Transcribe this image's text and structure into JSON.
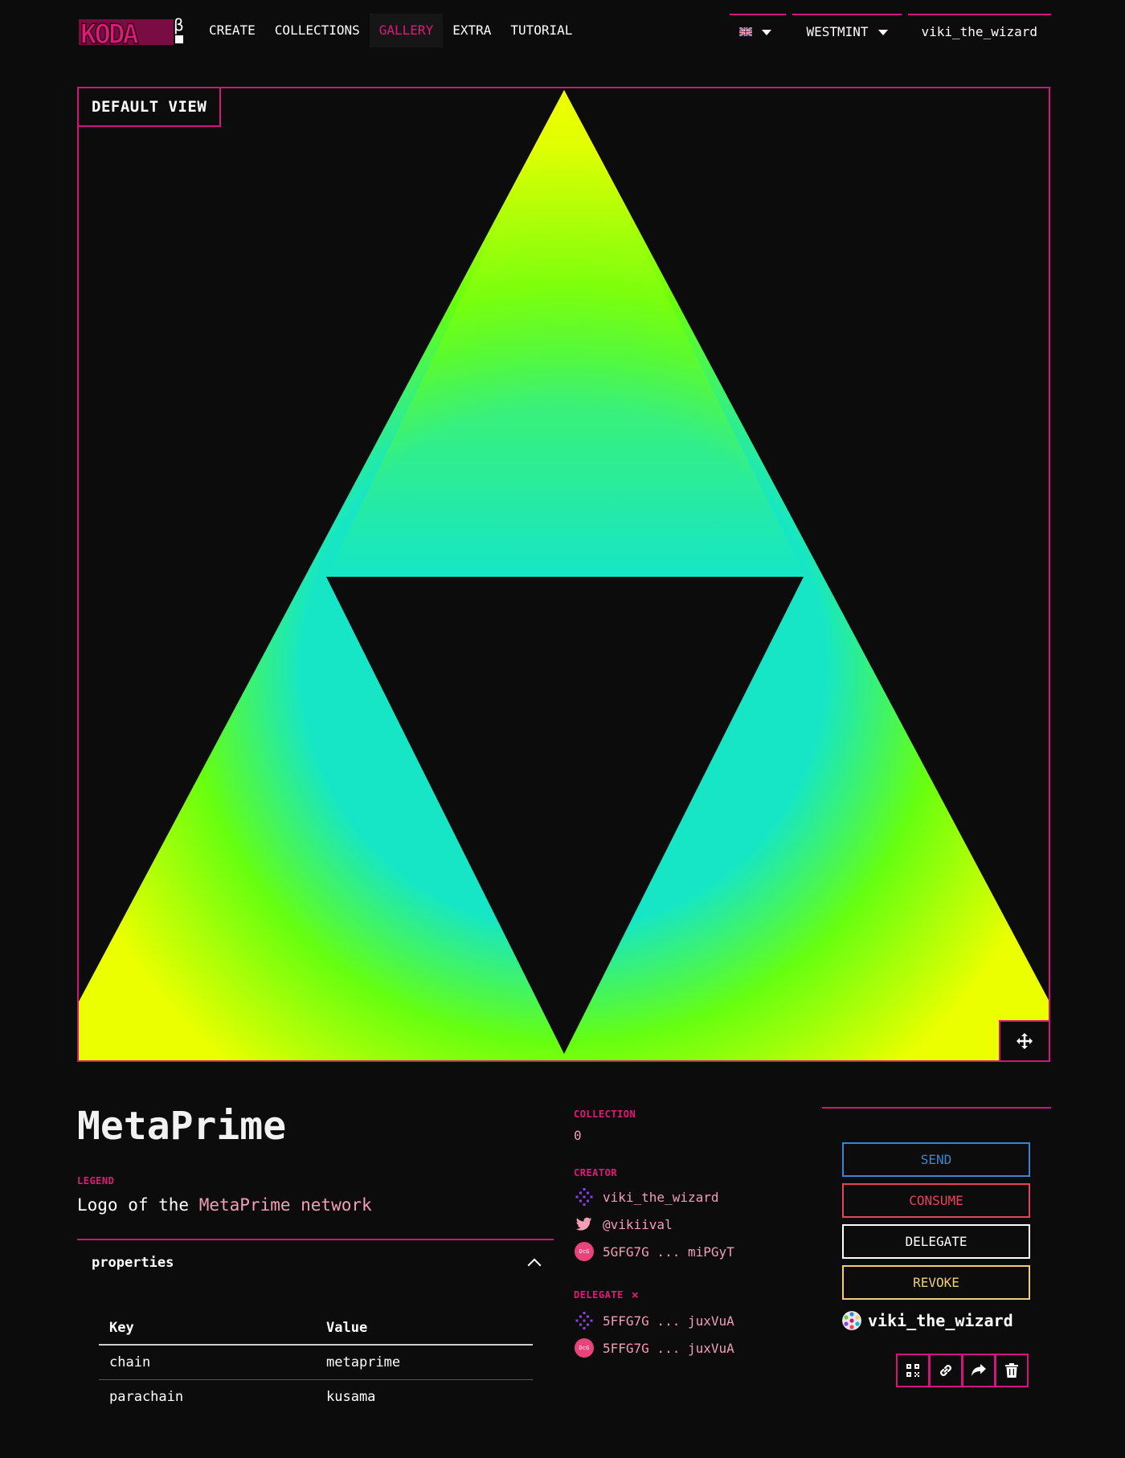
{
  "nav": {
    "logo_text": "KODA",
    "logo_badge": "β",
    "links": [
      {
        "label": "CREATE",
        "active": false
      },
      {
        "label": "COLLECTIONS",
        "active": false
      },
      {
        "label": "GALLERY",
        "active": true
      },
      {
        "label": "EXTRA",
        "active": false
      },
      {
        "label": "TUTORIAL",
        "active": false
      }
    ],
    "language_icon": "uk-flag-icon",
    "network_label": "WESTMINT",
    "account_label": "viki_the_wizard"
  },
  "media": {
    "view_label": "DEFAULT VIEW",
    "fullscreen_icon": "move-arrows-icon",
    "gradient_colors": [
      "#e8ff00",
      "#66ff00",
      "#16e6c6"
    ]
  },
  "nft": {
    "title": "MetaPrime",
    "legend_label": "LEGEND",
    "legend_prefix": "Logo of the ",
    "legend_highlight": "MetaPrime network",
    "properties_title": "properties",
    "properties_header": {
      "key": "Key",
      "value": "Value"
    },
    "properties": [
      {
        "key": "chain",
        "value": "metaprime"
      },
      {
        "key": "parachain",
        "value": "kusama"
      }
    ]
  },
  "meta": {
    "collection_label": "COLLECTION",
    "collection_value": "0",
    "creator_label": "CREATOR",
    "creator_name": "viki_the_wizard",
    "creator_twitter": "@vikiival",
    "creator_address": "5GFG7G ... miPGyT",
    "delegate_label": "DELEGATE",
    "delegate_close": "×",
    "delegate_identity": "5FFG7G ... juxVuA",
    "delegate_address": "5FFG7G ... juxVuA"
  },
  "actions": {
    "send": "SEND",
    "consume": "CONSUME",
    "delegate": "DELEGATE",
    "revoke": "REVOKE",
    "owner_name": "viki_the_wizard",
    "icons": [
      "qr-code-icon",
      "link-icon",
      "share-icon",
      "trash-icon"
    ]
  },
  "colors": {
    "accent": "#d3147c",
    "send": "#3a86d4",
    "consume": "#e8435c",
    "revoke": "#f2cf77",
    "highlight": "#f39eb6"
  }
}
